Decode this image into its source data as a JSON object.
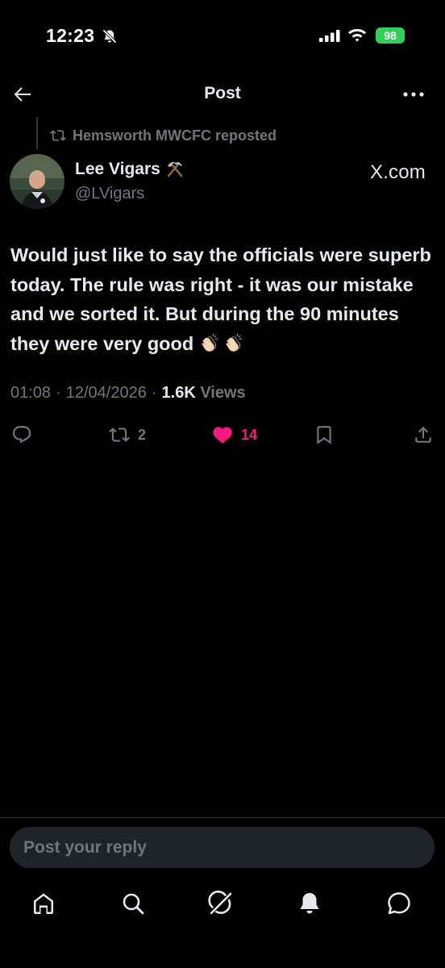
{
  "status_bar": {
    "time": "12:23",
    "battery": "98"
  },
  "header": {
    "title": "Post"
  },
  "repost": {
    "text": "Hemsworth MWCFC reposted"
  },
  "author": {
    "name": "Lee Vigars",
    "handle": "@LVigars",
    "name_icon": "hammer-and-pick-icon"
  },
  "source": {
    "label": "X.com"
  },
  "tweet": {
    "text": "Would just like to say the officials were superb today. The rule was right - it was our mistake and we sorted it. But during the 90 minutes they were very good",
    "emoji": [
      "clapping-hands-icon",
      "clapping-hands-icon"
    ]
  },
  "meta": {
    "time": "01:08",
    "date": "12/04/2026",
    "views_count": "1.6K",
    "views_label": "Views"
  },
  "actions": {
    "reply_count": "",
    "retweet_count": "2",
    "like_count": "14",
    "like_color": "#f91880"
  },
  "reply_box": {
    "placeholder": "Post your reply"
  },
  "tabbar": {
    "items": [
      "home-icon",
      "search-icon",
      "grok-icon",
      "notifications-icon",
      "messages-icon"
    ]
  }
}
